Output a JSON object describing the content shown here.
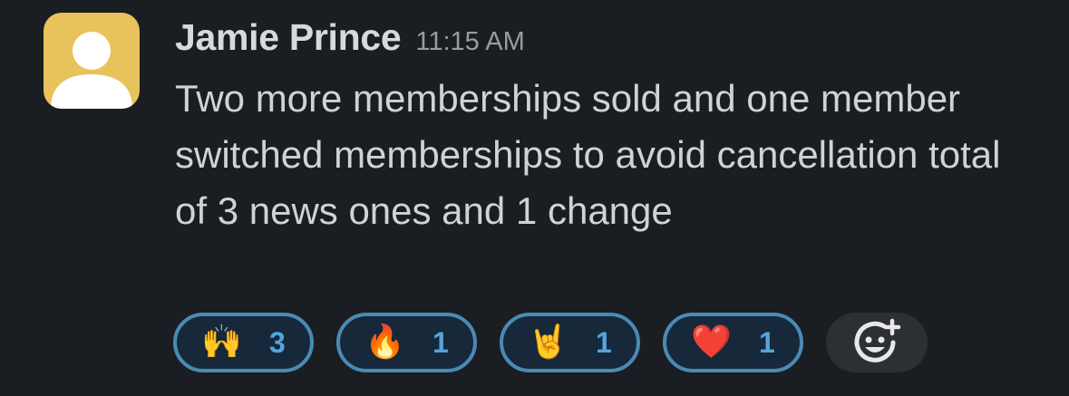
{
  "message": {
    "sender": "Jamie Prince",
    "timestamp": "11:15 AM",
    "text": "Two more memberships sold and one member switched memberships to avoid cancellation total of 3 news ones and 1 change",
    "avatar_icon": "default-user-avatar-icon",
    "avatar_color": "#e8c25a"
  },
  "reactions": [
    {
      "emoji": "🙌",
      "icon": "raising-hands-icon",
      "count": "3"
    },
    {
      "emoji": "🔥",
      "icon": "fire-icon",
      "count": "1"
    },
    {
      "emoji": "🤘",
      "icon": "sign-of-the-horns-icon",
      "count": "1"
    },
    {
      "emoji": "❤️",
      "icon": "red-heart-icon",
      "count": "1"
    }
  ],
  "add_reaction_icon": "add-reaction-icon",
  "colors": {
    "background": "#1a1d21",
    "reaction_border": "#4a8ab5",
    "reaction_count": "#56a4db"
  }
}
